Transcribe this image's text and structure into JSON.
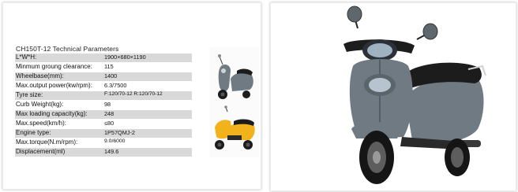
{
  "specs": {
    "title": "CH150T-12   Technical Parameters",
    "rows": [
      {
        "label": "L*W*H:",
        "value": "1900×680×1190"
      },
      {
        "label": "Minmum groung clearance:",
        "value": "115"
      },
      {
        "label": "Wheelbase(mm):",
        "value": "1400"
      },
      {
        "label": "Max.output power(kw/rpm):",
        "value": "6.3/7500"
      },
      {
        "label": "Tyre size:",
        "value": "F:120/70-12   R:120/70-12"
      },
      {
        "label": "Curb Weight(kg):",
        "value": "98"
      },
      {
        "label": "Max loading capacity(kg):",
        "value": "248"
      },
      {
        "label": "Max.speed(km/h):",
        "value": "≤80"
      },
      {
        "label": "Engine type:",
        "value": "1P57QMJ-2"
      },
      {
        "label": "Max.torque(N.m/rpm):",
        "value": "9.0/6000"
      },
      {
        "label": "Displacement(ml)",
        "value": "149.6"
      }
    ]
  },
  "colors": {
    "row_shade": "#d9d9d9",
    "scooter_gray": "#6f7a82",
    "scooter_yellow": "#f2b21c",
    "seat": "#1c1c1c"
  },
  "images": {
    "thumb_gray": "gray-scooter-thumbnail",
    "thumb_yellow": "yellow-scooter-thumbnail",
    "main": "gray-scooter-main-photo"
  }
}
